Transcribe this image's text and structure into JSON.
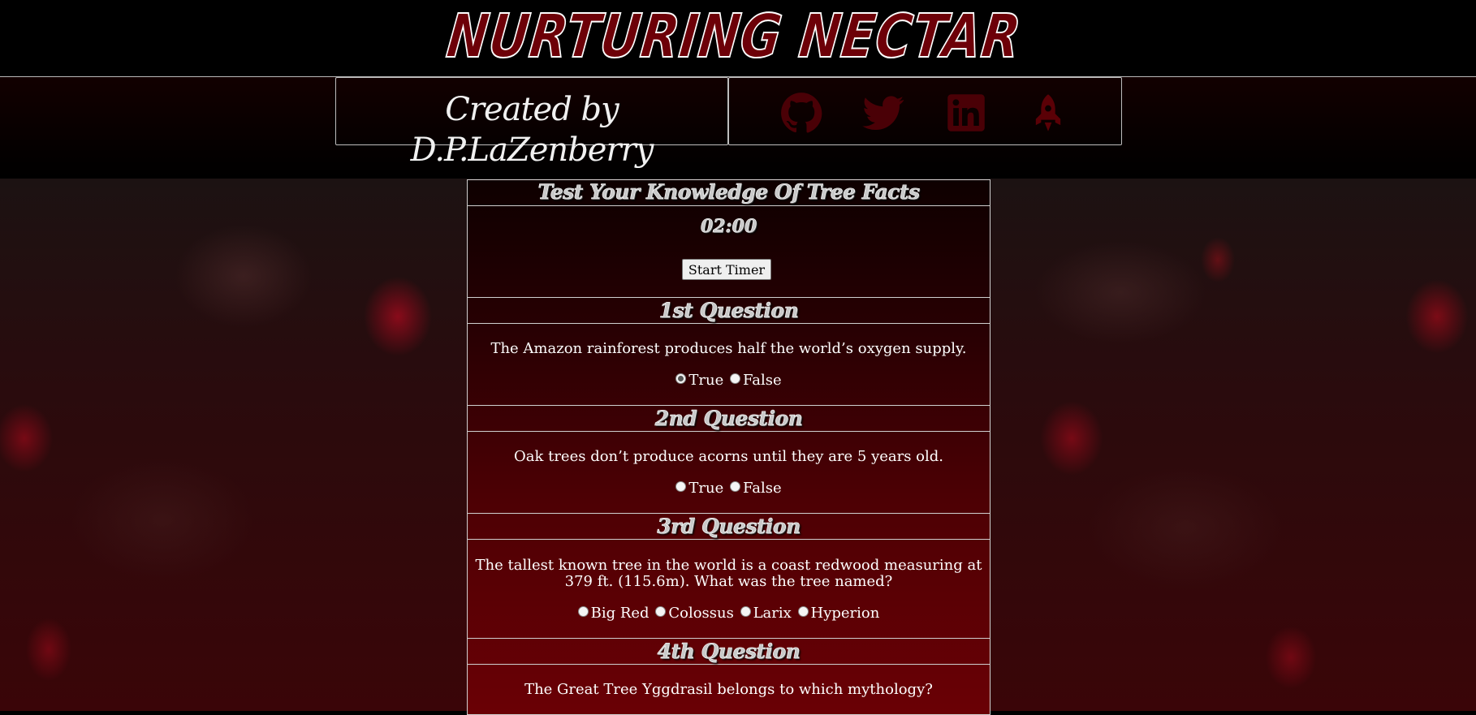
{
  "site": {
    "title": "NURTURING NECTAR",
    "byline": "Created by D.P.LaZenberry"
  },
  "social": [
    {
      "icon": "github-icon",
      "label": "GitHub"
    },
    {
      "icon": "twitter-icon",
      "label": "Twitter"
    },
    {
      "icon": "linkedin-icon",
      "label": "LinkedIn"
    },
    {
      "icon": "rocket-icon",
      "label": "Portfolio"
    }
  ],
  "quiz": {
    "heading": "Test Your Knowledge Of Tree Facts",
    "timer": "02:00",
    "start_label": "Start Timer",
    "questions": [
      {
        "heading": "1st Question",
        "text": "The Amazon rainforest produces half the world’s oxygen supply.",
        "options": [
          "True",
          "False"
        ],
        "selected": "True"
      },
      {
        "heading": "2nd Question",
        "text": "Oak trees don’t produce acorns until they are 5 years old.",
        "options": [
          "True",
          "False"
        ],
        "selected": null
      },
      {
        "heading": "3rd Question",
        "text": "The tallest known tree in the world is a coast redwood measuring at 379 ft. (115.6m). What was the tree named?",
        "options": [
          "Big Red",
          "Colossus",
          "Larix",
          "Hyperion"
        ],
        "selected": null
      },
      {
        "heading": "4th Question",
        "text": "The Great Tree Yggdrasil belongs to which mythology?",
        "options": [],
        "selected": null
      }
    ]
  },
  "colors": {
    "accent": "#6d0008",
    "icon": "#5a0006",
    "panel_bottom": "#6a0005"
  }
}
